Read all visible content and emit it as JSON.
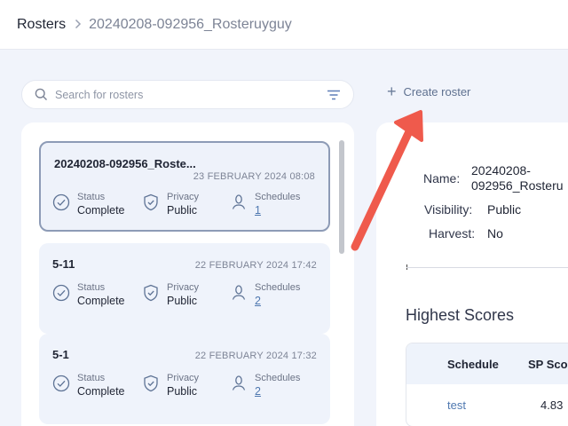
{
  "breadcrumb": {
    "root": "Rosters",
    "current": "20240208-092956_Rosteruyguy"
  },
  "search": {
    "placeholder": "Search for rosters",
    "icon": "search-icon",
    "filter_icon": "filter-icon"
  },
  "create_roster": {
    "label": "Create roster",
    "icon": "plus-icon"
  },
  "rosters": [
    {
      "name": "20240208-092956_Roste...",
      "date": "23 FEBRUARY 2024 08:08",
      "status_label": "Status",
      "status": "Complete",
      "privacy_label": "Privacy",
      "privacy": "Public",
      "schedules_label": "Schedules",
      "schedules": "1",
      "selected": true
    },
    {
      "name": "5-11",
      "date": "22 FEBRUARY 2024 17:42",
      "status_label": "Status",
      "status": "Complete",
      "privacy_label": "Privacy",
      "privacy": "Public",
      "schedules_label": "Schedules",
      "schedules": "2",
      "selected": false
    },
    {
      "name": "5-1",
      "date": "22 FEBRUARY 2024 17:32",
      "status_label": "Status",
      "status": "Complete",
      "privacy_label": "Privacy",
      "privacy": "Public",
      "schedules_label": "Schedules",
      "schedules": "2",
      "selected": false
    }
  ],
  "detail": {
    "name_label": "Name:",
    "name_line1": "20240208-",
    "name_line2": "092956_Rosteru",
    "visibility_label": "Visibility:",
    "visibility": "Public",
    "harvest_label": "Harvest:",
    "harvest": "No"
  },
  "scores": {
    "title": "Highest Scores",
    "columns": [
      "Schedule",
      "SP Sco"
    ],
    "rows": [
      [
        "test",
        "4.83"
      ]
    ]
  },
  "colors": {
    "accent": "#4f78b0",
    "arrow": "#ef5a4c",
    "card_bg": "#eff3fb"
  }
}
